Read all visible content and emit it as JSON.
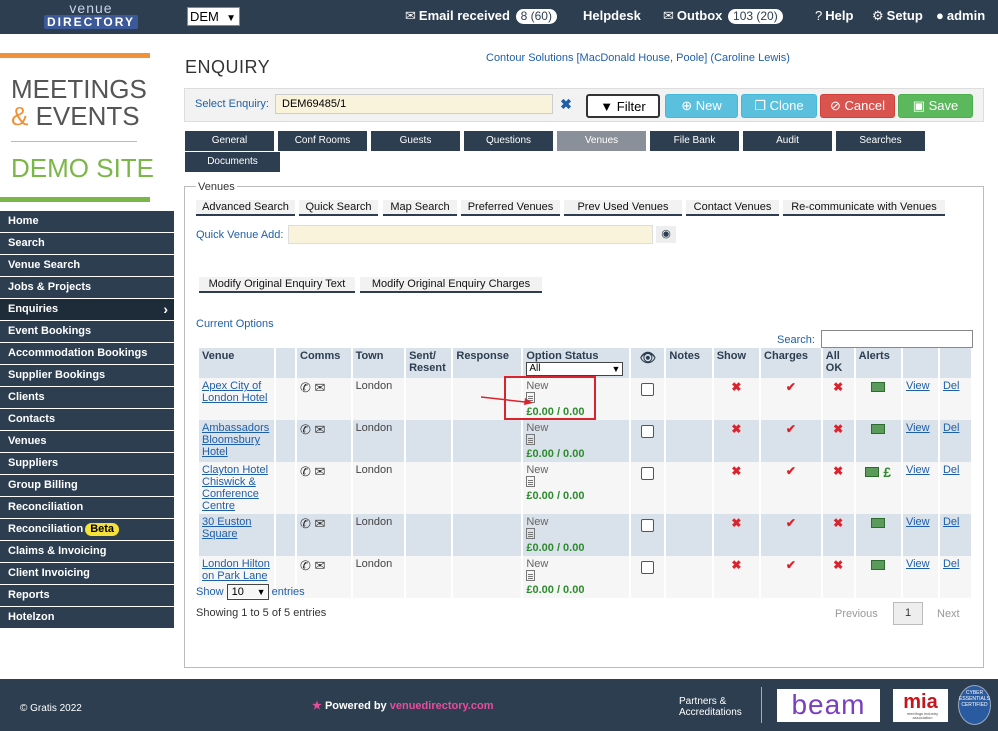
{
  "topbar": {
    "logo_line1": "venue",
    "logo_line2": "DIRECTORY",
    "site_select": "DEM",
    "email_received_label": "Email received",
    "email_received_count": "8 (60)",
    "helpdesk": "Helpdesk",
    "outbox_label": "Outbox",
    "outbox_count": "103 (20)",
    "help": "Help",
    "setup": "Setup",
    "user": "admin"
  },
  "brand": {
    "line1": "MEETINGS",
    "amp": "&",
    "line2": "EVENTS",
    "site": "DEMO SITE"
  },
  "sidebar": {
    "items": [
      {
        "label": "Home"
      },
      {
        "label": "Search"
      },
      {
        "label": "Venue Search"
      },
      {
        "label": "Jobs & Projects"
      },
      {
        "label": "Enquiries"
      },
      {
        "label": "Event Bookings"
      },
      {
        "label": "Accommodation Bookings"
      },
      {
        "label": "Supplier Bookings"
      },
      {
        "label": "Clients"
      },
      {
        "label": "Contacts"
      },
      {
        "label": "Venues"
      },
      {
        "label": "Suppliers"
      },
      {
        "label": "Group Billing"
      },
      {
        "label": "Reconciliation"
      },
      {
        "label": "Reconciliation",
        "badge": "Beta"
      },
      {
        "label": "Claims & Invoicing"
      },
      {
        "label": "Client Invoicing"
      },
      {
        "label": "Reports"
      },
      {
        "label": "Hotelzon"
      }
    ]
  },
  "page": {
    "title": "ENQUIRY",
    "company": "Contour Solutions [MacDonald House, Poole] (Caroline Lewis)",
    "select_label": "Select Enquiry:",
    "select_value": "DEM69485/1",
    "buttons": {
      "filter": "Filter",
      "new": "New",
      "clone": "Clone",
      "cancel": "Cancel",
      "save": "Save"
    },
    "tabs": [
      "General",
      "Conf Rooms",
      "Guests",
      "Questions",
      "Venues",
      "File Bank",
      "Audit",
      "Searches",
      "Documents"
    ]
  },
  "venues": {
    "legend": "Venues",
    "subtabs": [
      "Advanced Search",
      "Quick Search",
      "Map Search",
      "Preferred Venues",
      "Prev Used Venues",
      "Contact Venues",
      "Re-communicate with Venues"
    ],
    "quick_add_label": "Quick Venue Add:",
    "modify_text": "Modify Original Enquiry Text",
    "modify_charges": "Modify Original Enquiry Charges",
    "current_options": "Current Options",
    "search_label": "Search:",
    "columns": [
      "Venue",
      "",
      "Comms",
      "Town",
      "Sent/ Resent",
      "Response",
      "Option Status",
      "",
      "Notes",
      "Show",
      "Charges",
      "All OK",
      "Alerts",
      "",
      ""
    ],
    "status_filter": "All",
    "rows": [
      {
        "venue": "Apex City of London Hotel",
        "town": "London",
        "status": "New",
        "amount": "£0.00 / 0.00",
        "view": "View",
        "del": "Del"
      },
      {
        "venue": "Ambassadors Bloomsbury Hotel",
        "town": "London",
        "status": "New",
        "amount": "£0.00 / 0.00",
        "view": "View",
        "del": "Del"
      },
      {
        "venue": "Clayton Hotel Chiswick & Conference Centre",
        "town": "London",
        "status": "New",
        "amount": "£0.00 / 0.00",
        "view": "View",
        "del": "Del",
        "pound": "£"
      },
      {
        "venue": "30 Euston Square",
        "town": "London",
        "status": "New",
        "amount": "£0.00 / 0.00",
        "view": "View",
        "del": "Del"
      },
      {
        "venue": "London Hilton on Park Lane",
        "town": "London",
        "status": "New",
        "amount": "£0.00 / 0.00",
        "view": "View",
        "del": "Del"
      }
    ],
    "show_label": "Show",
    "show_value": "10",
    "entries_label": "entries",
    "showing": "Showing 1 to 5 of 5 entries",
    "previous": "Previous",
    "page": "1",
    "next": "Next"
  },
  "footer": {
    "copyright": "© Gratis 2022",
    "powered_by": "Powered by",
    "powered_brand": "venuedirectory.com",
    "partners_line1": "Partners &",
    "partners_line2": "Accreditations",
    "beam": "beam",
    "mia": "mia",
    "cyber": "CYBER ESSENTIALS CERTIFIED"
  },
  "colors": {
    "nav": "#2c3e50",
    "accent_orange": "#f0923b",
    "accent_green": "#7ab648",
    "highlight": "#d9232d"
  }
}
